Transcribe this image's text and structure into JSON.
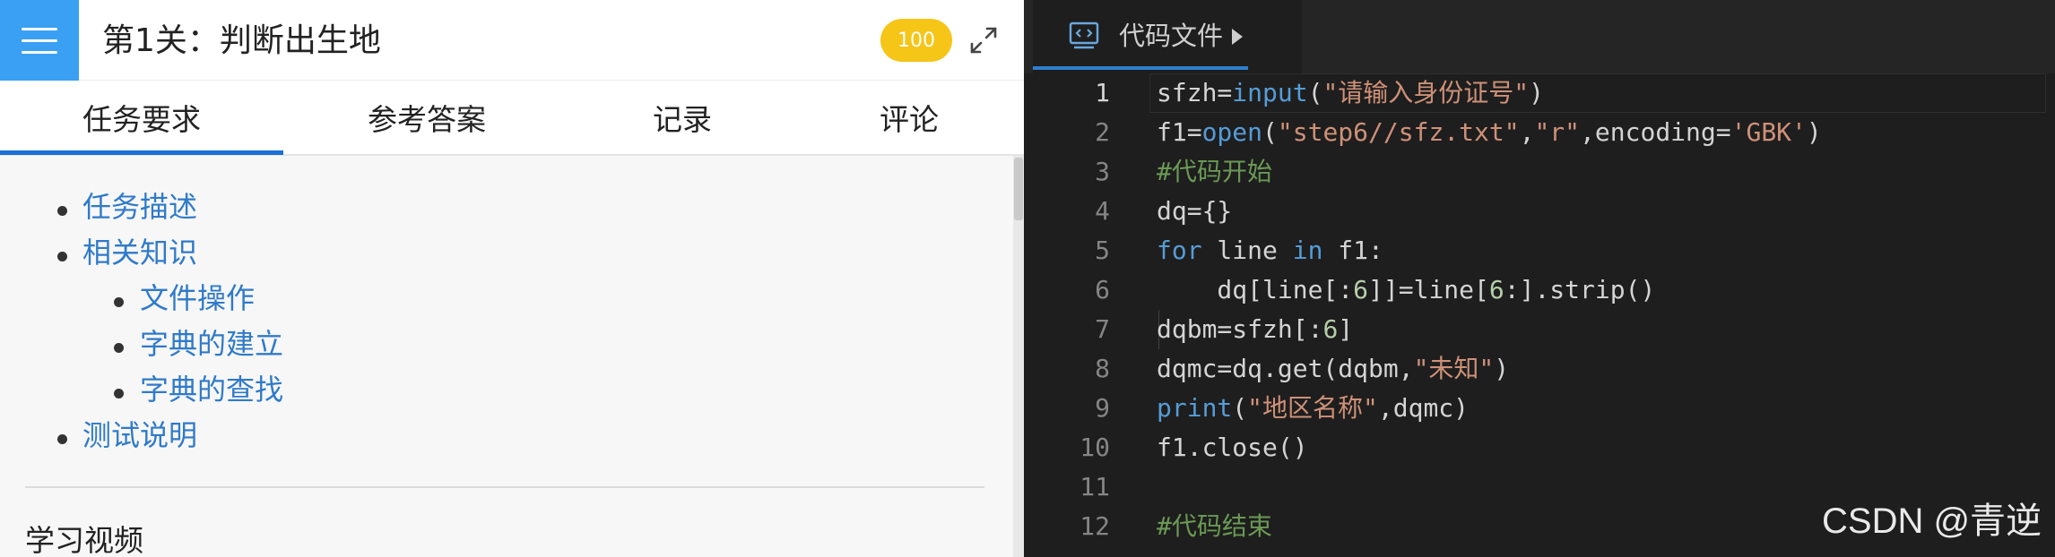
{
  "header": {
    "title": "第1关：判断出生地",
    "score": "100"
  },
  "tabs": [
    {
      "label": "任务要求"
    },
    {
      "label": "参考答案"
    },
    {
      "label": "记录"
    },
    {
      "label": "评论"
    }
  ],
  "toc": {
    "items": [
      {
        "label": "任务描述"
      },
      {
        "label": "相关知识"
      },
      {
        "label": "文件操作"
      },
      {
        "label": "字典的建立"
      },
      {
        "label": "字典的查找"
      },
      {
        "label": "测试说明"
      }
    ],
    "section_title": "学习视频"
  },
  "editor": {
    "tab_label": "代码文件",
    "line_numbers": [
      "1",
      "2",
      "3",
      "4",
      "5",
      "6",
      "7",
      "8",
      "9",
      "10",
      "11",
      "12"
    ],
    "lines": [
      [
        {
          "t": "sfzh=",
          "c": "plain"
        },
        {
          "t": "input",
          "c": "kw"
        },
        {
          "t": "(",
          "c": "plain"
        },
        {
          "t": "\"请输入身份证号\"",
          "c": "str"
        },
        {
          "t": ")",
          "c": "plain"
        }
      ],
      [
        {
          "t": "f1=",
          "c": "plain"
        },
        {
          "t": "open",
          "c": "kw"
        },
        {
          "t": "(",
          "c": "plain"
        },
        {
          "t": "\"step6//sfz.txt\"",
          "c": "str"
        },
        {
          "t": ",",
          "c": "plain"
        },
        {
          "t": "\"r\"",
          "c": "str"
        },
        {
          "t": ",encoding=",
          "c": "plain"
        },
        {
          "t": "'GBK'",
          "c": "str"
        },
        {
          "t": ")",
          "c": "plain"
        }
      ],
      [
        {
          "t": "#代码开始",
          "c": "cmt"
        }
      ],
      [
        {
          "t": "dq={}",
          "c": "plain"
        }
      ],
      [
        {
          "t": "for",
          "c": "kw"
        },
        {
          "t": " line ",
          "c": "plain"
        },
        {
          "t": "in",
          "c": "kw"
        },
        {
          "t": " f1:",
          "c": "plain"
        }
      ],
      [
        {
          "t": "    dq[line[:",
          "c": "plain"
        },
        {
          "t": "6",
          "c": "num"
        },
        {
          "t": "]]=line[",
          "c": "plain"
        },
        {
          "t": "6",
          "c": "num"
        },
        {
          "t": ":].strip()",
          "c": "plain"
        }
      ],
      [
        {
          "t": "dqbm=sfzh[:",
          "c": "plain"
        },
        {
          "t": "6",
          "c": "num"
        },
        {
          "t": "]",
          "c": "plain"
        }
      ],
      [
        {
          "t": "dqmc=dq.get(dqbm,",
          "c": "plain"
        },
        {
          "t": "\"未知\"",
          "c": "str"
        },
        {
          "t": ")",
          "c": "plain"
        }
      ],
      [
        {
          "t": "print",
          "c": "kw"
        },
        {
          "t": "(",
          "c": "plain"
        },
        {
          "t": "\"地区名称\"",
          "c": "str"
        },
        {
          "t": ",dqmc)",
          "c": "plain"
        }
      ],
      [
        {
          "t": "f1.close()",
          "c": "plain"
        }
      ],
      [],
      [
        {
          "t": "#代码结束",
          "c": "cmt"
        }
      ]
    ]
  },
  "watermark": "CSDN @青逆",
  "colors": {
    "menu_bg": "#3aa0f4",
    "score_badge": "#f5c518",
    "tab_active_underline": "#1a6fd8",
    "link": "#2f7ac9",
    "editor_bg": "#1e1e1e",
    "keyword": "#569cd6",
    "string": "#ce9178",
    "comment": "#6a9955",
    "number": "#b5cea8"
  }
}
